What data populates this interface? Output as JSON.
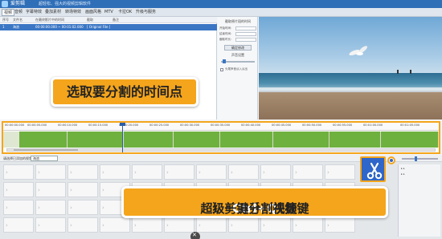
{
  "window": {
    "app_name": "爱剪辑",
    "subtitle": "超轻松、强大的视频剪辑软件"
  },
  "menu": [
    "视频",
    "音频",
    "字幕特效",
    "叠加素材",
    "转场特效",
    "画面风格",
    "MTV",
    "卡拉OK",
    "升级与服务"
  ],
  "list": {
    "headers": [
      "序号",
      "文件名",
      "在最终影片中的时间",
      "截取",
      "备注"
    ],
    "rows": [
      {
        "index": "1",
        "name": "海浪",
        "time": "00:00:00.000 ~ 00:01:02.000",
        "clip": "[ Original File ]"
      }
    ]
  },
  "settings_panel": {
    "section1": "截取原片段的时间",
    "start_label": "开始时间:",
    "end_label": "结束时间:",
    "duration_label": "截取时长:",
    "button": "确定修改",
    "section2": "声音设置",
    "checkbox_label": "头尾声音淡入淡出"
  },
  "tooltip_top": "选取要分割的时间点",
  "timeline": {
    "tick_labels": [
      "00:00:00.000",
      "00:00:05.000",
      "00:00:10.000",
      "00:00:15.000",
      "00:00:20.000",
      "00:00:25.000",
      "00:00:30.000",
      "00:00:35.000",
      "00:00:40.000",
      "00:00:45.000",
      "00:00:50.000",
      "00:00:55.000",
      "00:01:00.000",
      "00:01:05.000"
    ]
  },
  "lower": {
    "label": "请选择已添加的视频",
    "select_value": "海浪"
  },
  "tooltip_bottom": {
    "prefix": "超级剪刀手（快捷键",
    "hotkey": "Ctrl+Q",
    "suffix": "）一键分割视频"
  },
  "icons": {
    "scissors": "scissors-icon",
    "close": "close-icon"
  },
  "colors": {
    "accent": "#f4a51c",
    "brand": "#2f66c9",
    "wave": "#6fb13f"
  }
}
